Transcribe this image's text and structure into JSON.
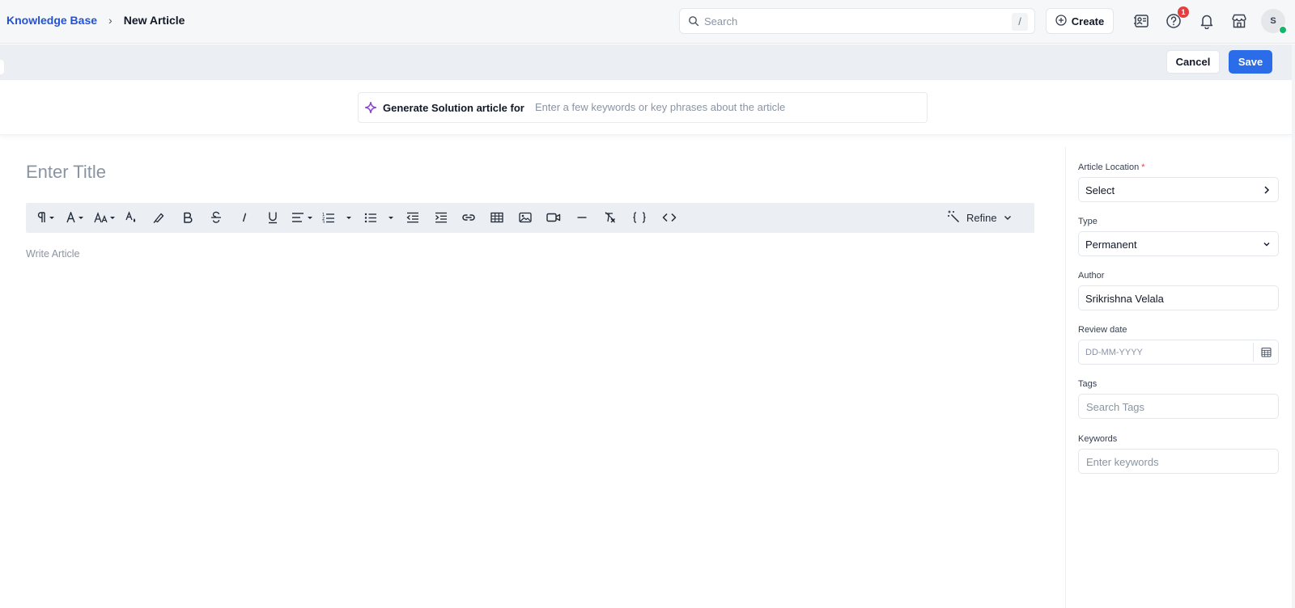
{
  "breadcrumb": {
    "parent": "Knowledge Base",
    "separator": "›",
    "current": "New Article"
  },
  "search": {
    "placeholder": "Search",
    "shortcut": "/"
  },
  "header": {
    "create_label": "Create",
    "help_badge_count": "1",
    "avatar_initial": "S"
  },
  "actions": {
    "cancel_label": "Cancel",
    "save_label": "Save"
  },
  "generator": {
    "label": "Generate Solution article for",
    "placeholder": "Enter a few keywords or key phrases about the article"
  },
  "editor": {
    "title_placeholder": "Enter Title",
    "body_placeholder": "Write Article",
    "refine_label": "Refine",
    "toolbar_icons": [
      "paragraph-format-icon",
      "font-family-icon",
      "font-size-icon",
      "text-color-icon",
      "highlight-icon",
      "bold-icon",
      "strikethrough-icon",
      "italic-icon",
      "underline-icon",
      "align-icon",
      "ordered-list-icon",
      "unordered-list-icon",
      "outdent-icon",
      "indent-icon",
      "link-icon",
      "table-icon",
      "image-icon",
      "video-icon",
      "horizontal-rule-icon",
      "clear-formatting-icon",
      "code-block-icon",
      "source-code-icon"
    ]
  },
  "sidebar": {
    "article_location": {
      "label": "Article Location",
      "required_mark": "*",
      "value": "Select"
    },
    "type": {
      "label": "Type",
      "value": "Permanent"
    },
    "author": {
      "label": "Author",
      "value": "Srikrishna Velala"
    },
    "review_date": {
      "label": "Review date",
      "placeholder": "DD-MM-YYYY"
    },
    "tags": {
      "label": "Tags",
      "placeholder": "Search Tags"
    },
    "keywords": {
      "label": "Keywords",
      "placeholder": "Enter keywords"
    }
  },
  "colors": {
    "accent": "#2b6de8",
    "link": "#2152d8",
    "badge": "#e53e3e",
    "presence": "#12b76a",
    "ai_spark": "#8b3fd9"
  }
}
